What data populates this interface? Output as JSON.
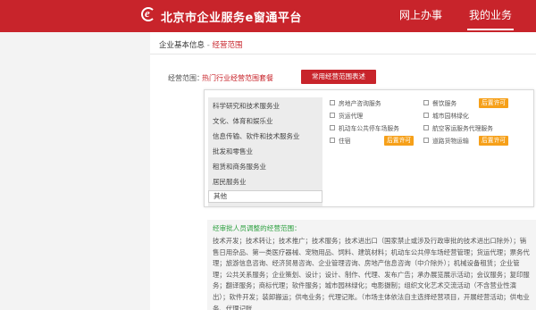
{
  "header": {
    "logo_letter": "e",
    "brand": "北京市企业服务e窗通平台",
    "nav": [
      {
        "label": "网上办事"
      },
      {
        "label": "我的业务"
      }
    ]
  },
  "breadcrumb": {
    "parent": "企业基本信息",
    "separator": " - ",
    "current": "经营范围"
  },
  "scope": {
    "label": "经营范围：",
    "link": "热门行业经营范围套餐",
    "button": "常用经营范围表述"
  },
  "categories": [
    "科学研究和技术服务业",
    "文化、体育和娱乐业",
    "信息传输、软件和技术服务业",
    "批发和零售业",
    "租赁和商务服务业",
    "居民服务业",
    "其他"
  ],
  "options": [
    {
      "label": "房地产咨询服务"
    },
    {
      "label": "餐饮服务",
      "badge": "后置许可"
    },
    {
      "label": "货运代理"
    },
    {
      "label": "城市园林绿化"
    },
    {
      "label": "机动车公共停车场服务"
    },
    {
      "label": "航空客运服务代理服务",
      "badge": "后置许可"
    },
    {
      "label": "住宿",
      "badge": "后置许可"
    },
    {
      "label": "道路货物运输",
      "badge": "后置许可"
    }
  ],
  "approval": {
    "title": "经审批人员调整的经营范围：",
    "body": "技术开发；技术转让；技术推广；技术服务；技术进出口（国家禁止或涉及行政审批的技术进出口除外）；销售日用杂品、第一类医疗器械、宠物用品、饲料、建筑材料；机动车公共停车场经营管理；货运代理；票务代理；旅游信息咨询、经济贸易咨询、企业管理咨询、房地产信息咨询（中介除外）；机械设备租赁；企业管理；公共关系服务；企业策划、设计；设计、制作、代理、发布广告；承办展览展示活动；会议服务；复印服务；翻译服务；商标代理；软件服务；城市园林绿化；电影摄制；组织文化艺术交流活动（不含营业性演出）；软件开发；装卸搬运；供电业务；代理记账。（市场主体依法自主选择经营项目，开展经营活动；供电业务、代理记账"
  },
  "colors": {
    "brand_red": "#c8242b",
    "badge_orange": "#f6a019",
    "approval_green": "#2b9f3e"
  }
}
